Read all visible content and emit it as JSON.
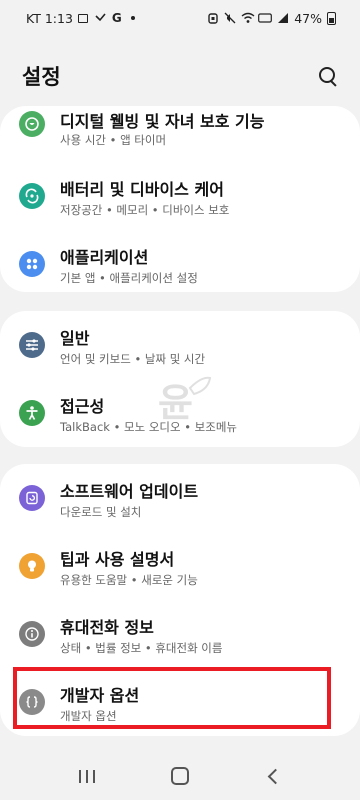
{
  "status_bar": {
    "carrier_time": "KT 1:13",
    "left_icons": [
      "gallery-icon",
      "missed-call-icon",
      "google-icon",
      "notification-dot-icon"
    ],
    "right_icons": [
      "alarm-icon",
      "mute-icon",
      "wifi-icon",
      "volte-icon",
      "signal-icon"
    ],
    "battery": "47%"
  },
  "header": {
    "title": "설정",
    "search_icon": "search-icon"
  },
  "sections": [
    {
      "items": [
        {
          "title": "디지털 웰빙 및 자녀 보호 기능",
          "subtitle": "사용 시간  •  앱 타이머",
          "icon": "wellbeing-icon",
          "color": "#4cae63"
        },
        {
          "title": "배터리 및 디바이스 케어",
          "subtitle": "저장공간  •  메모리  •  디바이스 보호",
          "icon": "device-care-icon",
          "color": "#21a98f"
        },
        {
          "title": "애플리케이션",
          "subtitle": "기본 앱  •  애플리케이션 설정",
          "icon": "apps-icon",
          "color": "#4b8ef0"
        }
      ]
    },
    {
      "items": [
        {
          "title": "일반",
          "subtitle": "언어 및 키보드  •  날짜 및 시간",
          "icon": "general-management-icon",
          "color": "#4e6b8c"
        },
        {
          "title": "접근성",
          "subtitle": "TalkBack  •  모노 오디오  •  보조메뉴",
          "icon": "accessibility-icon",
          "color": "#3aa251"
        }
      ]
    },
    {
      "items": [
        {
          "title": "소프트웨어 업데이트",
          "subtitle": "다운로드 및 설치",
          "icon": "software-update-icon",
          "color": "#7b62d6"
        },
        {
          "title": "팁과 사용 설명서",
          "subtitle": "유용한 도움말  •  새로운 기능",
          "icon": "tips-icon",
          "color": "#f0a233"
        },
        {
          "title": "휴대전화 정보",
          "subtitle": "상태  •  법률 정보  •  휴대전화 이름",
          "icon": "phone-info-icon",
          "color": "#7d7d7d"
        },
        {
          "title": "개발자 옵션",
          "subtitle": "개발자 옵션",
          "icon": "developer-options-icon",
          "color": "#8a8a8a"
        }
      ]
    }
  ],
  "watermark": {
    "text": "윤"
  },
  "nav_bar": {
    "icons": [
      "recent-apps-icon",
      "home-icon",
      "back-icon"
    ]
  },
  "colors": {
    "background": "#f2f2f2",
    "card": "#ffffff",
    "highlight": "#ec1c24"
  }
}
